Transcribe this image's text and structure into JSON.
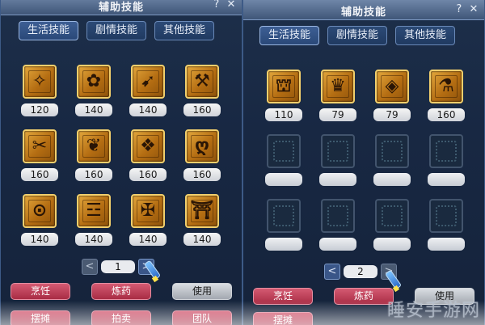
{
  "left": {
    "title": "辅助技能",
    "help_glyph": "?",
    "close_glyph": "✕",
    "side_glyph": "⇄",
    "tabs": [
      {
        "label": "生活技能",
        "active": true
      },
      {
        "label": "剧情技能",
        "active": false
      },
      {
        "label": "其他技能",
        "active": false
      }
    ],
    "skills": [
      {
        "value": "120",
        "icon": "skill-guard-icon",
        "glyph": "✧"
      },
      {
        "value": "140",
        "icon": "skill-hunt-icon",
        "glyph": "✿"
      },
      {
        "value": "140",
        "icon": "skill-craft-icon",
        "glyph": "➹"
      },
      {
        "value": "160",
        "icon": "skill-forge-icon",
        "glyph": "⚒"
      },
      {
        "value": "160",
        "icon": "skill-cross-icon",
        "glyph": "✂"
      },
      {
        "value": "160",
        "icon": "skill-herb-icon",
        "glyph": "❦"
      },
      {
        "value": "160",
        "icon": "skill-weave-icon",
        "glyph": "❖"
      },
      {
        "value": "160",
        "icon": "skill-cook-icon",
        "glyph": "ღ"
      },
      {
        "value": "140",
        "icon": "skill-ring-icon",
        "glyph": "⊙"
      },
      {
        "value": "140",
        "icon": "skill-scroll-icon",
        "glyph": "☲"
      },
      {
        "value": "140",
        "icon": "skill-rune-icon",
        "glyph": "✠"
      },
      {
        "value": "140",
        "icon": "skill-gate-icon",
        "glyph": "⛩"
      }
    ],
    "pager": {
      "prev": "<",
      "next": ">",
      "page": "1"
    },
    "actions": [
      {
        "label": "烹饪",
        "style": "red"
      },
      {
        "label": "炼药",
        "style": "red"
      },
      {
        "label": "使用",
        "style": "grey"
      },
      {
        "label": "摆摊",
        "style": "red"
      },
      {
        "label": "拍卖",
        "style": "red"
      },
      {
        "label": "团队",
        "style": "red"
      }
    ]
  },
  "right": {
    "title": "辅助技能",
    "help_glyph": "?",
    "close_glyph": "✕",
    "side_glyph": "⇄",
    "tabs": [
      {
        "label": "生活技能",
        "active": true
      },
      {
        "label": "剧情技能",
        "active": false
      },
      {
        "label": "其他技能",
        "active": false
      }
    ],
    "skills": [
      {
        "value": "110",
        "icon": "skill-shrine-icon",
        "glyph": "⛫"
      },
      {
        "value": "79",
        "icon": "skill-crown-icon",
        "glyph": "♛"
      },
      {
        "value": "79",
        "icon": "skill-gem-icon",
        "glyph": "◈"
      },
      {
        "value": "160",
        "icon": "skill-mortar-icon",
        "glyph": "⚗"
      },
      {
        "value": "",
        "icon": "empty-slot-icon",
        "glyph": ""
      },
      {
        "value": "",
        "icon": "empty-slot-icon",
        "glyph": ""
      },
      {
        "value": "",
        "icon": "empty-slot-icon",
        "glyph": ""
      },
      {
        "value": "",
        "icon": "empty-slot-icon",
        "glyph": ""
      },
      {
        "value": "",
        "icon": "empty-slot-icon",
        "glyph": ""
      },
      {
        "value": "",
        "icon": "empty-slot-icon",
        "glyph": ""
      },
      {
        "value": "",
        "icon": "empty-slot-icon",
        "glyph": ""
      },
      {
        "value": "",
        "icon": "empty-slot-icon",
        "glyph": ""
      }
    ],
    "pager": {
      "prev": "<",
      "next": ">",
      "page": "2"
    },
    "actions": [
      {
        "label": "烹饪",
        "style": "red"
      },
      {
        "label": "炼药",
        "style": "red"
      },
      {
        "label": "使用",
        "style": "grey"
      },
      {
        "label": "摆摊",
        "style": "red"
      }
    ]
  },
  "watermark": "睡安手游网"
}
